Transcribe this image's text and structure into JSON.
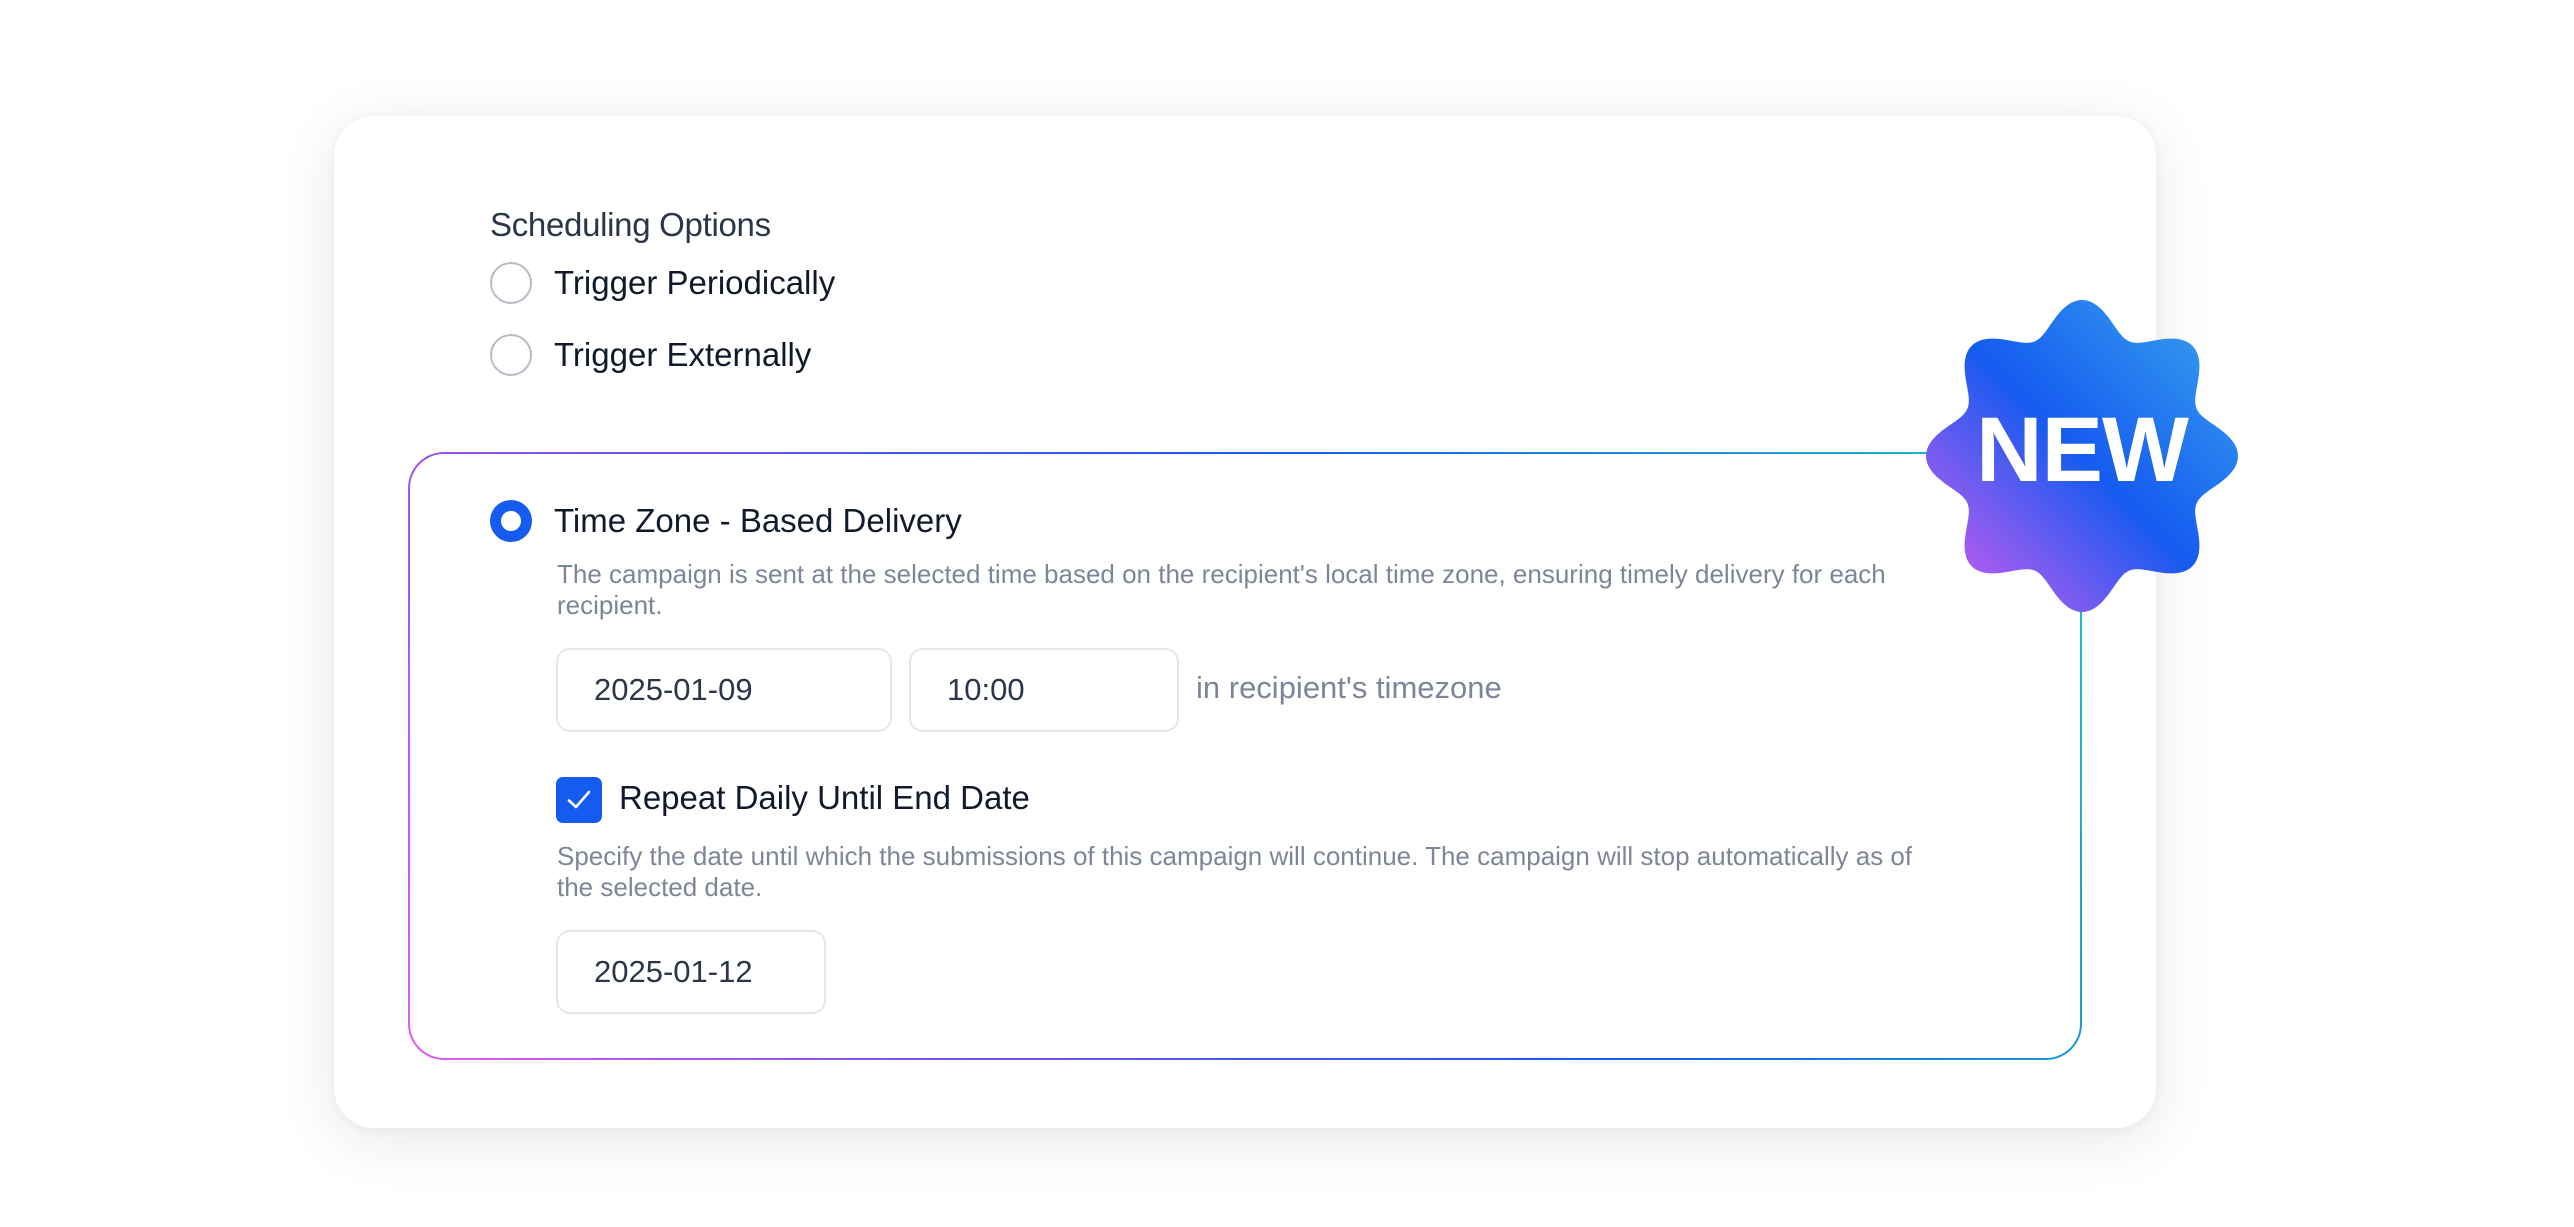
{
  "section": {
    "title": "Scheduling Options"
  },
  "options": {
    "periodic": {
      "label": "Trigger Periodically",
      "selected": false
    },
    "external": {
      "label": "Trigger Externally",
      "selected": false
    },
    "timezone": {
      "label": "Time Zone - Based Delivery",
      "selected": true,
      "description": "The campaign is sent at the selected time based on the recipient's local time zone, ensuring timely delivery for each recipient.",
      "date_value": "2025-01-09",
      "time_value": "10:00",
      "suffix": "in recipient's timezone"
    }
  },
  "repeat": {
    "label": "Repeat Daily Until End Date",
    "checked": true,
    "description": "Specify the date until which the submissions of this campaign will continue. The campaign will stop automatically as of the selected date.",
    "end_date_value": "2025-01-12"
  },
  "badge": {
    "text": "NEW"
  },
  "colors": {
    "accent": "#155bf0",
    "badge_gradient": [
      "#e25cf0",
      "#155bf0",
      "#3aa8ee"
    ],
    "box_border_gradient": [
      "#e25cf0",
      "#155bf0",
      "#22c6c2"
    ]
  },
  "icons": {
    "checkbox": "check-icon",
    "badge": "scalloped-badge-icon"
  }
}
